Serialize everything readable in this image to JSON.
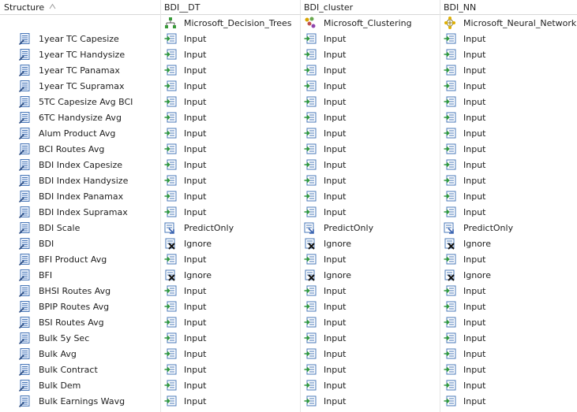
{
  "header": {
    "structure_label": "Structure",
    "models": [
      "BDI__DT",
      "BDI_cluster",
      "BDI_NN"
    ],
    "algorithms": [
      "Microsoft_Decision_Trees",
      "Microsoft_Clustering",
      "Microsoft_Neural_Network"
    ]
  },
  "rows": [
    {
      "name": "1year TC Capesize",
      "usage": [
        "Input",
        "Input",
        "Input"
      ]
    },
    {
      "name": "1year TC Handysize",
      "usage": [
        "Input",
        "Input",
        "Input"
      ]
    },
    {
      "name": "1year TC Panamax",
      "usage": [
        "Input",
        "Input",
        "Input"
      ]
    },
    {
      "name": "1year TC Supramax",
      "usage": [
        "Input",
        "Input",
        "Input"
      ]
    },
    {
      "name": "5TC Capesize Avg BCI",
      "usage": [
        "Input",
        "Input",
        "Input"
      ]
    },
    {
      "name": "6TC Handysize Avg",
      "usage": [
        "Input",
        "Input",
        "Input"
      ]
    },
    {
      "name": "Alum Product Avg",
      "usage": [
        "Input",
        "Input",
        "Input"
      ]
    },
    {
      "name": "BCI Routes Avg",
      "usage": [
        "Input",
        "Input",
        "Input"
      ]
    },
    {
      "name": "BDI Index Capesize",
      "usage": [
        "Input",
        "Input",
        "Input"
      ]
    },
    {
      "name": "BDI Index Handysize",
      "usage": [
        "Input",
        "Input",
        "Input"
      ]
    },
    {
      "name": "BDI Index Panamax",
      "usage": [
        "Input",
        "Input",
        "Input"
      ]
    },
    {
      "name": "BDI Index Supramax",
      "usage": [
        "Input",
        "Input",
        "Input"
      ]
    },
    {
      "name": "BDI Scale",
      "usage": [
        "PredictOnly",
        "PredictOnly",
        "PredictOnly"
      ]
    },
    {
      "name": "BDI",
      "usage": [
        "Ignore",
        "Ignore",
        "Ignore"
      ]
    },
    {
      "name": "BFI Product Avg",
      "usage": [
        "Input",
        "Input",
        "Input"
      ]
    },
    {
      "name": "BFI",
      "usage": [
        "Ignore",
        "Ignore",
        "Ignore"
      ]
    },
    {
      "name": "BHSI Routes Avg",
      "usage": [
        "Input",
        "Input",
        "Input"
      ]
    },
    {
      "name": "BPIP Routes Avg",
      "usage": [
        "Input",
        "Input",
        "Input"
      ]
    },
    {
      "name": "BSI Routes Avg",
      "usage": [
        "Input",
        "Input",
        "Input"
      ]
    },
    {
      "name": "Bulk 5y Sec",
      "usage": [
        "Input",
        "Input",
        "Input"
      ]
    },
    {
      "name": "Bulk Avg",
      "usage": [
        "Input",
        "Input",
        "Input"
      ]
    },
    {
      "name": "Bulk Contract",
      "usage": [
        "Input",
        "Input",
        "Input"
      ]
    },
    {
      "name": "Bulk Dem",
      "usage": [
        "Input",
        "Input",
        "Input"
      ]
    },
    {
      "name": "Bulk Earnings Wavg",
      "usage": [
        "Input",
        "Input",
        "Input"
      ]
    }
  ]
}
